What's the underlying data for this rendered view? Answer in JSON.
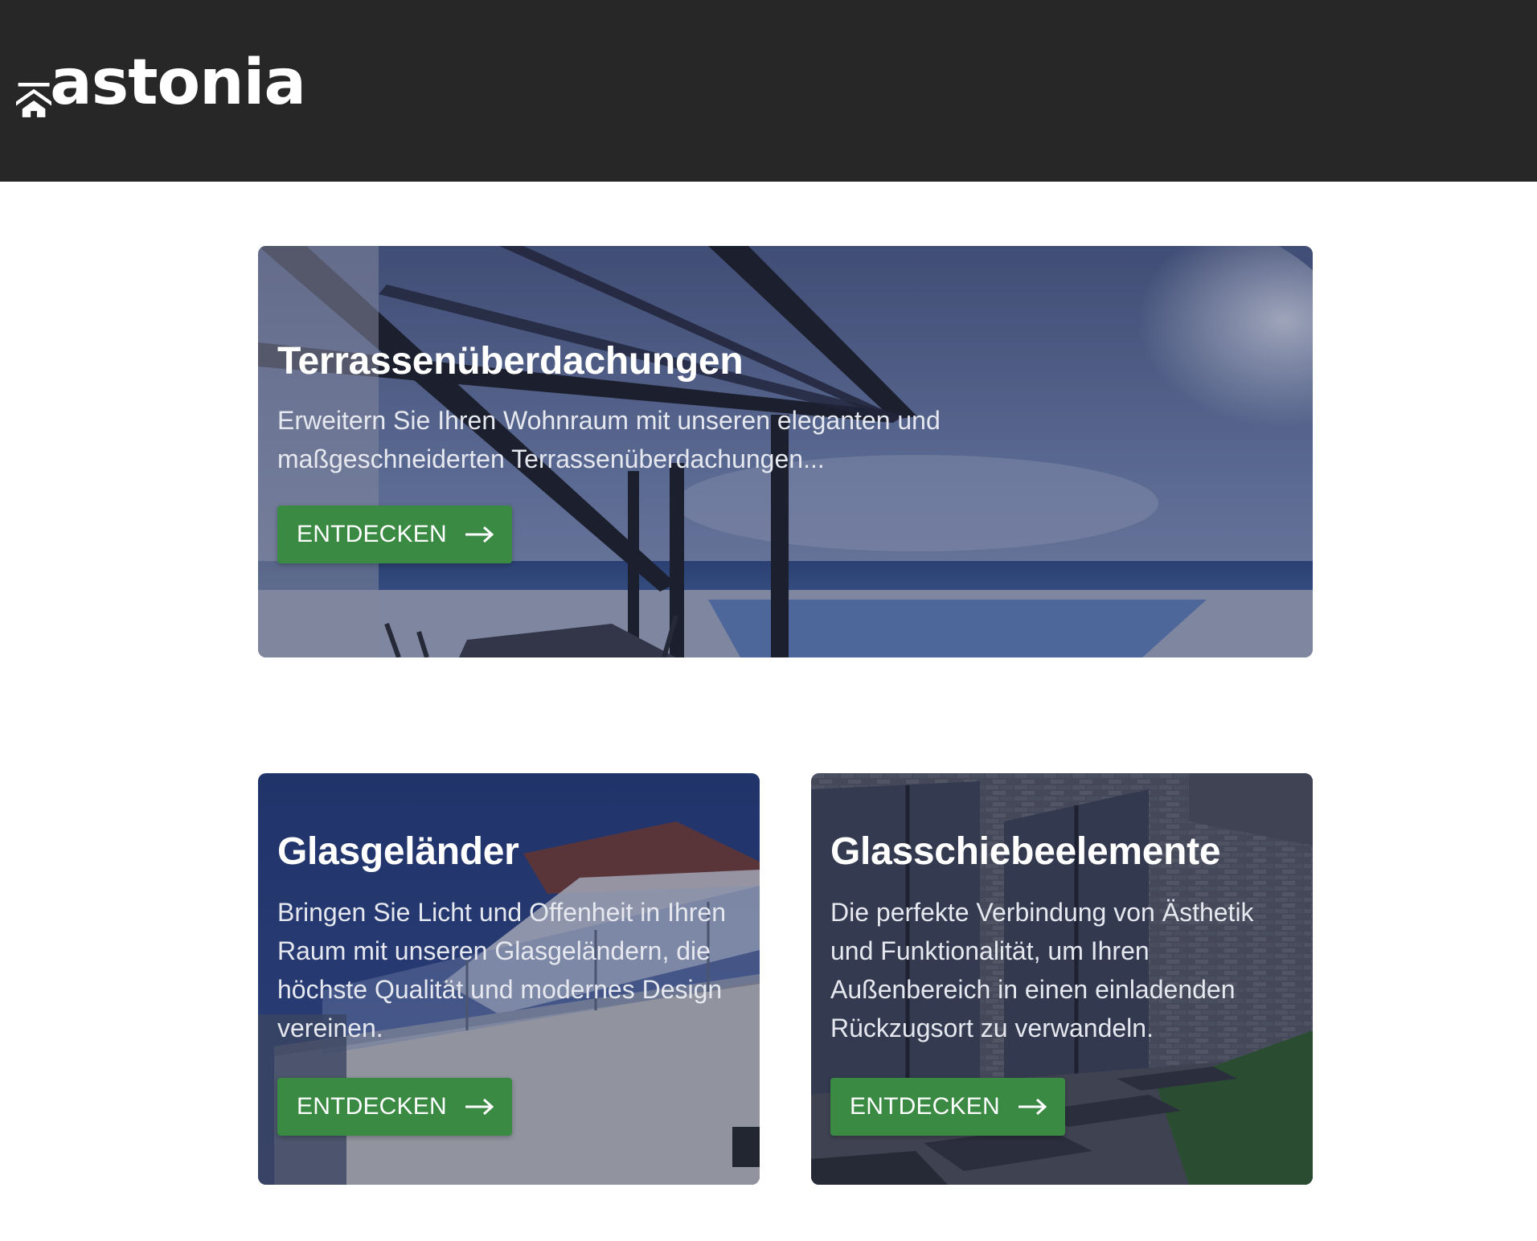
{
  "header": {
    "logo_text": "astonia",
    "logo_icon": "roof-house-icon",
    "background": "#272727"
  },
  "theme": {
    "button_color": "#3a8a44",
    "text_color": "#ffffff"
  },
  "cards": [
    {
      "title": "Terrassenüberdachungen",
      "text": "Erweitern Sie Ihren Wohnraum mit unseren eleganten und maßgeschneiderten Terrassenüberdachungen...",
      "button_label": "ENTDECKEN",
      "button_icon": "arrow-right-icon"
    },
    {
      "title": "Glasgeländer",
      "text": "Bringen Sie Licht und Offenheit in Ihren Raum mit unseren Glasgeländern, die höchste Qualität und modernes Design vereinen.",
      "button_label": "ENTDECKEN",
      "button_icon": "arrow-right-icon"
    },
    {
      "title": "Glasschiebeelemente",
      "text": "Die perfekte Verbindung von Ästhetik und Funktionalität, um Ihren Außenbereich in einen einladenden Rückzugsort zu verwandeln.",
      "button_label": "ENTDECKEN",
      "button_icon": "arrow-right-icon"
    }
  ]
}
